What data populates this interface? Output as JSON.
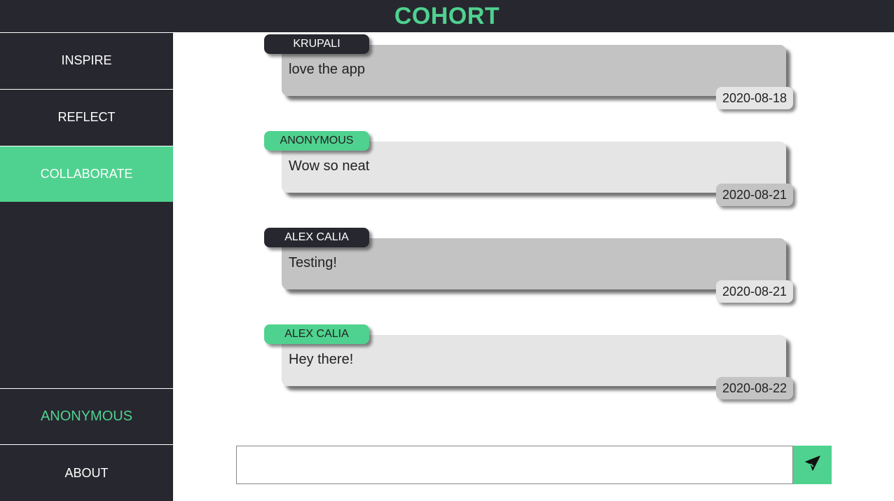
{
  "app": {
    "title": "COHORT"
  },
  "colors": {
    "accent": "#4fd28f",
    "dark": "#27272f",
    "bubble_dark": "#c3c3c3",
    "bubble_light": "#e5e5e5"
  },
  "sidebar": {
    "items": [
      {
        "label": "INSPIRE"
      },
      {
        "label": "REFLECT"
      },
      {
        "label": "COLLABORATE",
        "active": true
      }
    ],
    "user_label": "ANONYMOUS",
    "about_label": "ABOUT"
  },
  "messages": [
    {
      "author": "KRUPALI",
      "text": "love the app",
      "date": "2020-08-18"
    },
    {
      "author": "ANONYMOUS",
      "text": "Wow so neat",
      "date": "2020-08-21"
    },
    {
      "author": "ALEX CALIA",
      "text": "Testing!",
      "date": "2020-08-21"
    },
    {
      "author": "ALEX CALIA",
      "text": "Hey there!",
      "date": "2020-08-22"
    }
  ],
  "composer": {
    "value": "",
    "placeholder": "",
    "send_icon": "paper-plane-icon"
  }
}
